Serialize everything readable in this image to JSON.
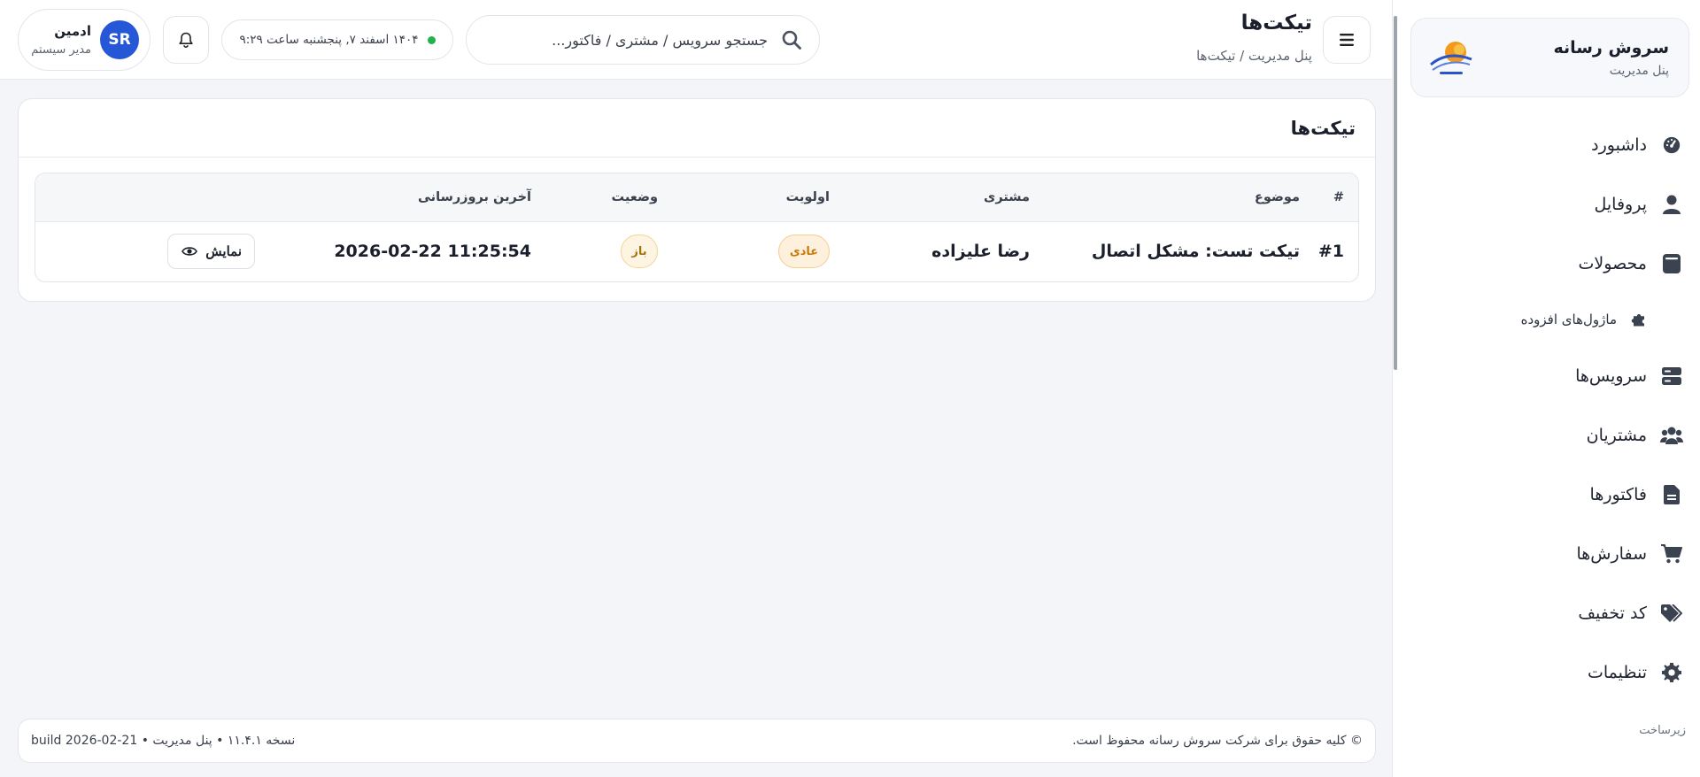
{
  "brand": {
    "title": "سروش رسانه",
    "subtitle": "پنل مدیریت"
  },
  "sidebar": {
    "items": [
      {
        "label": "داشبورد",
        "icon": "gauge-icon"
      },
      {
        "label": "پروفایل",
        "icon": "user-icon"
      },
      {
        "label": "محصولات",
        "icon": "box-icon"
      },
      {
        "label": "ماژول‌های افزوده",
        "icon": "puzzle-icon"
      },
      {
        "label": "سرویس‌ها",
        "icon": "server-icon"
      },
      {
        "label": "مشتریان",
        "icon": "users-icon"
      },
      {
        "label": "فاکتورها",
        "icon": "file-invoice-icon"
      },
      {
        "label": "سفارش‌ها",
        "icon": "cart-icon"
      },
      {
        "label": "کد تخفیف",
        "icon": "tags-icon"
      },
      {
        "label": "تنظیمات",
        "icon": "gear-icon"
      }
    ],
    "section_label": "زیرساخت"
  },
  "header": {
    "title": "تیکت‌ها",
    "breadcrumb": "پنل مدیریت / تیکت‌ها",
    "search_placeholder": "جستجو سرویس / مشتری / فاکتور...",
    "datetime": "۱۴۰۴ اسفند ۷, پنجشنبه ساعت ۹:۲۹",
    "status_color": "#22b24c",
    "user": {
      "initials": "SR",
      "name": "ادمین",
      "role": "مدیر سیستم"
    }
  },
  "card": {
    "title": "تیکت‌ها",
    "columns": [
      "#",
      "موضوع",
      "مشتری",
      "اولویت",
      "وضعیت",
      "آخرین بروزرسانی",
      ""
    ],
    "rows": [
      {
        "id": "#1",
        "subject": "تیکت تست: مشکل اتصال",
        "customer": "رضا علیزاده",
        "priority": "عادی",
        "status": "باز",
        "updated": "2026-02-22 11:25:54",
        "action": "نمایش"
      }
    ]
  },
  "footer": {
    "copyright": "© کلیه حقوق برای شرکت سروش رسانه محفوظ است.",
    "version": "نسخه ۱۱.۴.۱ • پنل مدیریت • build 2026-02-21"
  },
  "colors": {
    "accent": "#2657d6",
    "warning": "#c77a08",
    "success": "#22b24c"
  }
}
